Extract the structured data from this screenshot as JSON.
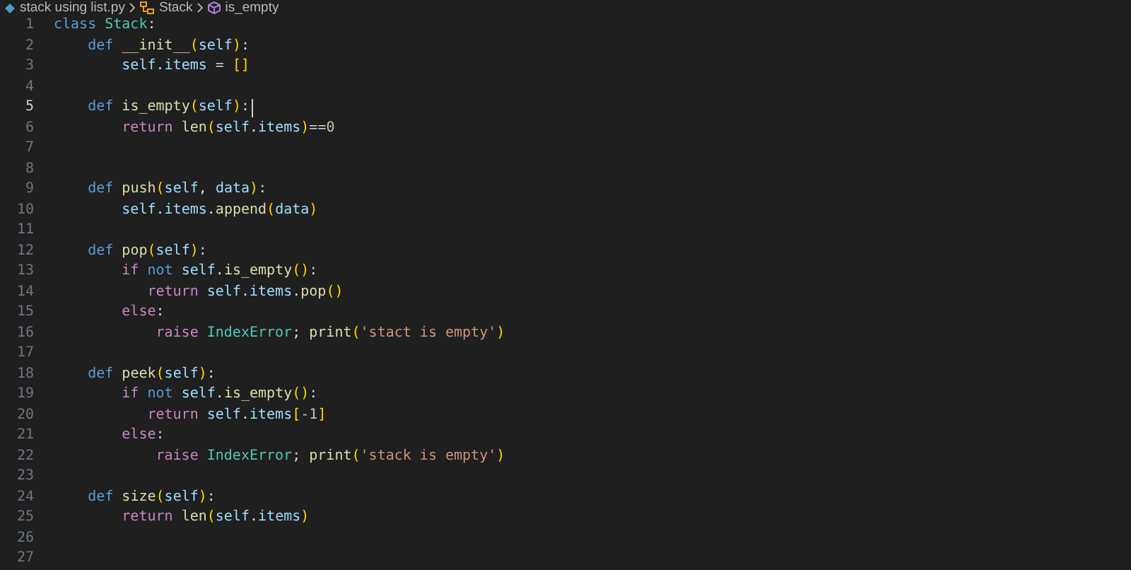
{
  "breadcrumb": [
    {
      "kind": "file",
      "label": "stack using list.py"
    },
    {
      "kind": "class",
      "label": "Stack"
    },
    {
      "kind": "method",
      "label": "is_empty"
    }
  ],
  "lines": [
    {
      "number": "1",
      "current": false,
      "tokens": [
        {
          "kind": "kw",
          "text": "class "
        },
        {
          "kind": "cls",
          "text": "Stack"
        },
        {
          "kind": "txt",
          "text": ":"
        }
      ]
    },
    {
      "number": "2",
      "current": false,
      "tokens": [
        {
          "kind": "kw",
          "text": "    def "
        },
        {
          "kind": "fn",
          "text": "__init__"
        },
        {
          "kind": "br",
          "text": "("
        },
        {
          "kind": "var",
          "text": "self"
        },
        {
          "kind": "br",
          "text": ")"
        },
        {
          "kind": "txt",
          "text": ":"
        }
      ]
    },
    {
      "number": "3",
      "current": false,
      "tokens": [
        {
          "kind": "var",
          "text": "        self"
        },
        {
          "kind": "txt",
          "text": "."
        },
        {
          "kind": "var",
          "text": "items"
        },
        {
          "kind": "txt",
          "text": " = "
        },
        {
          "kind": "br",
          "text": "[]"
        }
      ]
    },
    {
      "number": "4",
      "current": false
    },
    {
      "number": "5",
      "current": true,
      "tokens": [
        {
          "kind": "kw",
          "text": "    def "
        },
        {
          "kind": "fn",
          "text": "is_empty"
        },
        {
          "kind": "br",
          "text": "("
        },
        {
          "kind": "var",
          "text": "self"
        },
        {
          "kind": "br",
          "text": ")"
        },
        {
          "kind": "txt",
          "text": ":"
        }
      ]
    },
    {
      "number": "6",
      "current": false,
      "tokens": [
        {
          "kind": "ctl",
          "text": "        return "
        },
        {
          "kind": "fn",
          "text": "len"
        },
        {
          "kind": "br",
          "text": "("
        },
        {
          "kind": "var",
          "text": "self"
        },
        {
          "kind": "txt",
          "text": "."
        },
        {
          "kind": "var",
          "text": "items"
        },
        {
          "kind": "br",
          "text": ")"
        },
        {
          "kind": "txt",
          "text": "=="
        },
        {
          "kind": "num",
          "text": "0"
        }
      ]
    },
    {
      "number": "7",
      "current": false
    },
    {
      "number": "8",
      "current": false
    },
    {
      "number": "9",
      "current": false,
      "tokens": [
        {
          "kind": "kw",
          "text": "    def "
        },
        {
          "kind": "fn",
          "text": "push"
        },
        {
          "kind": "br",
          "text": "("
        },
        {
          "kind": "var",
          "text": "self"
        },
        {
          "kind": "txt",
          "text": ", "
        },
        {
          "kind": "var",
          "text": "data"
        },
        {
          "kind": "br",
          "text": ")"
        },
        {
          "kind": "txt",
          "text": ":"
        }
      ]
    },
    {
      "number": "10",
      "current": false,
      "tokens": [
        {
          "kind": "var",
          "text": "        self"
        },
        {
          "kind": "txt",
          "text": "."
        },
        {
          "kind": "var",
          "text": "items"
        },
        {
          "kind": "txt",
          "text": "."
        },
        {
          "kind": "fn",
          "text": "append"
        },
        {
          "kind": "br",
          "text": "("
        },
        {
          "kind": "var",
          "text": "data"
        },
        {
          "kind": "br",
          "text": ")"
        }
      ]
    },
    {
      "number": "11",
      "current": false
    },
    {
      "number": "12",
      "current": false,
      "tokens": [
        {
          "kind": "kw",
          "text": "    def "
        },
        {
          "kind": "fn",
          "text": "pop"
        },
        {
          "kind": "br",
          "text": "("
        },
        {
          "kind": "var",
          "text": "self"
        },
        {
          "kind": "br",
          "text": ")"
        },
        {
          "kind": "txt",
          "text": ":"
        }
      ]
    },
    {
      "number": "13",
      "current": false,
      "tokens": [
        {
          "kind": "ctl",
          "text": "        if "
        },
        {
          "kind": "kw",
          "text": "not "
        },
        {
          "kind": "var",
          "text": "self"
        },
        {
          "kind": "txt",
          "text": "."
        },
        {
          "kind": "fn",
          "text": "is_empty"
        },
        {
          "kind": "br",
          "text": "()"
        },
        {
          "kind": "txt",
          "text": ":"
        }
      ]
    },
    {
      "number": "14",
      "current": false,
      "tokens": [
        {
          "kind": "ctl",
          "text": "           return "
        },
        {
          "kind": "var",
          "text": "self"
        },
        {
          "kind": "txt",
          "text": "."
        },
        {
          "kind": "var",
          "text": "items"
        },
        {
          "kind": "txt",
          "text": "."
        },
        {
          "kind": "fn",
          "text": "pop"
        },
        {
          "kind": "br",
          "text": "()"
        }
      ]
    },
    {
      "number": "15",
      "current": false,
      "tokens": [
        {
          "kind": "ctl",
          "text": "        else"
        },
        {
          "kind": "txt",
          "text": ":"
        }
      ]
    },
    {
      "number": "16",
      "current": false,
      "tokens": [
        {
          "kind": "ctl",
          "text": "            raise "
        },
        {
          "kind": "cls",
          "text": "IndexError"
        },
        {
          "kind": "txt",
          "text": "; "
        },
        {
          "kind": "fn",
          "text": "print"
        },
        {
          "kind": "br",
          "text": "("
        },
        {
          "kind": "str",
          "text": "'stact is empty'"
        },
        {
          "kind": "br",
          "text": ")"
        }
      ]
    },
    {
      "number": "17",
      "current": false
    },
    {
      "number": "18",
      "current": false,
      "tokens": [
        {
          "kind": "kw",
          "text": "    def "
        },
        {
          "kind": "fn",
          "text": "peek"
        },
        {
          "kind": "br",
          "text": "("
        },
        {
          "kind": "var",
          "text": "self"
        },
        {
          "kind": "br",
          "text": ")"
        },
        {
          "kind": "txt",
          "text": ":"
        }
      ]
    },
    {
      "number": "19",
      "current": false,
      "tokens": [
        {
          "kind": "ctl",
          "text": "        if "
        },
        {
          "kind": "kw",
          "text": "not "
        },
        {
          "kind": "var",
          "text": "self"
        },
        {
          "kind": "txt",
          "text": "."
        },
        {
          "kind": "fn",
          "text": "is_empty"
        },
        {
          "kind": "br",
          "text": "()"
        },
        {
          "kind": "txt",
          "text": ":"
        }
      ]
    },
    {
      "number": "20",
      "current": false,
      "tokens": [
        {
          "kind": "ctl",
          "text": "           return "
        },
        {
          "kind": "var",
          "text": "self"
        },
        {
          "kind": "txt",
          "text": "."
        },
        {
          "kind": "var",
          "text": "items"
        },
        {
          "kind": "br",
          "text": "["
        },
        {
          "kind": "num",
          "text": "-1"
        },
        {
          "kind": "br",
          "text": "]"
        }
      ]
    },
    {
      "number": "21",
      "current": false,
      "tokens": [
        {
          "kind": "ctl",
          "text": "        else"
        },
        {
          "kind": "txt",
          "text": ":"
        }
      ]
    },
    {
      "number": "22",
      "current": false,
      "tokens": [
        {
          "kind": "ctl",
          "text": "            raise "
        },
        {
          "kind": "cls",
          "text": "IndexError"
        },
        {
          "kind": "txt",
          "text": "; "
        },
        {
          "kind": "fn",
          "text": "print"
        },
        {
          "kind": "br",
          "text": "("
        },
        {
          "kind": "str",
          "text": "'stack is empty'"
        },
        {
          "kind": "br",
          "text": ")"
        }
      ]
    },
    {
      "number": "23",
      "current": false
    },
    {
      "number": "24",
      "current": false,
      "tokens": [
        {
          "kind": "kw",
          "text": "    def "
        },
        {
          "kind": "fn",
          "text": "size"
        },
        {
          "kind": "br",
          "text": "("
        },
        {
          "kind": "var",
          "text": "self"
        },
        {
          "kind": "br",
          "text": ")"
        },
        {
          "kind": "txt",
          "text": ":"
        }
      ]
    },
    {
      "number": "25",
      "current": false,
      "tokens": [
        {
          "kind": "ctl",
          "text": "        return "
        },
        {
          "kind": "fn",
          "text": "len"
        },
        {
          "kind": "br",
          "text": "("
        },
        {
          "kind": "var",
          "text": "self"
        },
        {
          "kind": "txt",
          "text": "."
        },
        {
          "kind": "var",
          "text": "items"
        },
        {
          "kind": "br",
          "text": ")"
        }
      ]
    },
    {
      "number": "26",
      "current": false
    },
    {
      "number": "27",
      "current": false
    }
  ]
}
